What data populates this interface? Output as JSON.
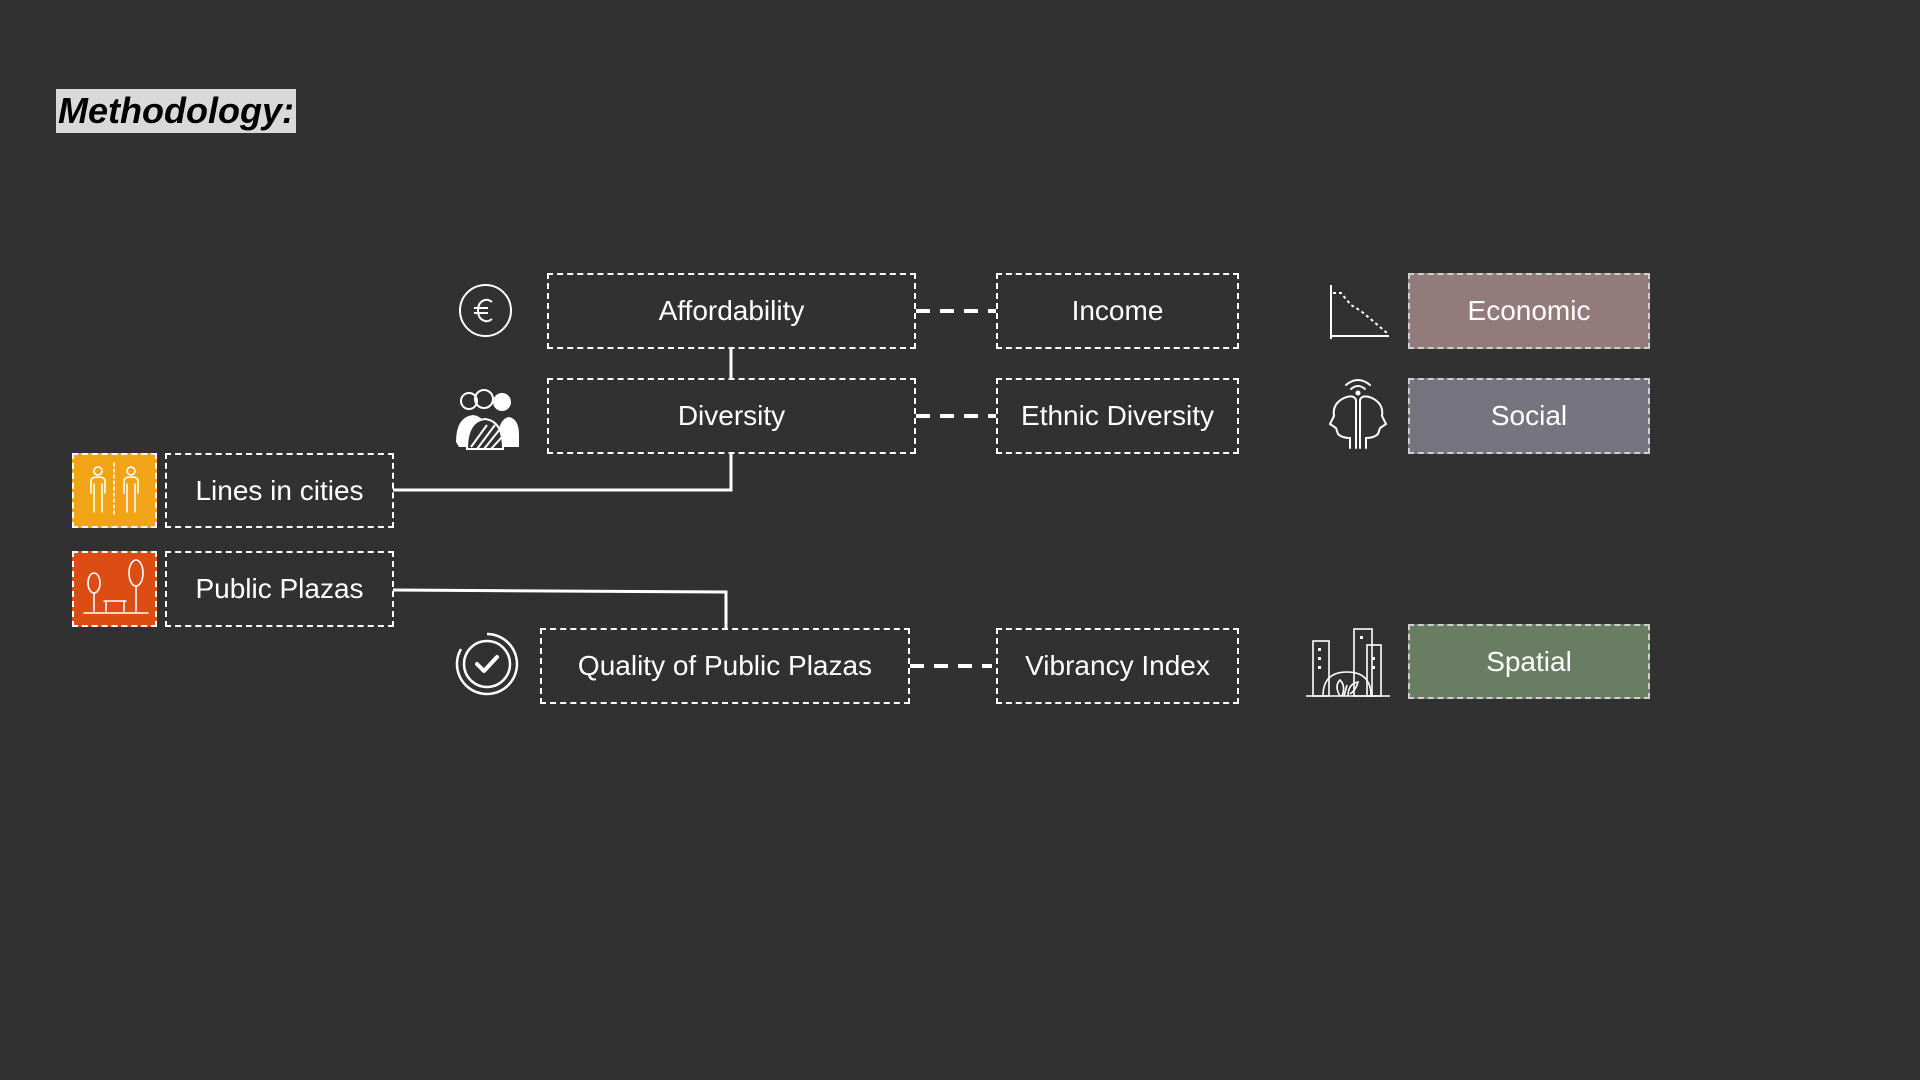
{
  "title": "Methodology:",
  "colors": {
    "background": "#313131",
    "economic": "#937b7b",
    "social": "#76757f",
    "spatial": "#697d63",
    "lines_tile": "#f1a415",
    "plazas_tile": "#db4d12"
  },
  "sources": {
    "lines": {
      "label": "Lines in cities",
      "icon": "people-queue-icon"
    },
    "plazas": {
      "label": "Public Plazas",
      "icon": "park-bench-icon"
    }
  },
  "criteria": {
    "affordability": {
      "label": "Affordability",
      "icon": "euro-icon"
    },
    "diversity": {
      "label": "Diversity",
      "icon": "people-group-icon"
    },
    "quality": {
      "label": "Quality of Public Plazas",
      "icon": "check-circle-icon"
    }
  },
  "indicators": {
    "income": "Income",
    "ethnic": "Ethnic Diversity",
    "vibrancy": "Vibrancy Index"
  },
  "categories": {
    "economic": {
      "label": "Economic",
      "icon": "declining-chart-icon"
    },
    "social": {
      "label": "Social",
      "icon": "heads-signal-icon"
    },
    "spatial": {
      "label": "Spatial",
      "icon": "city-buildings-icon"
    }
  }
}
